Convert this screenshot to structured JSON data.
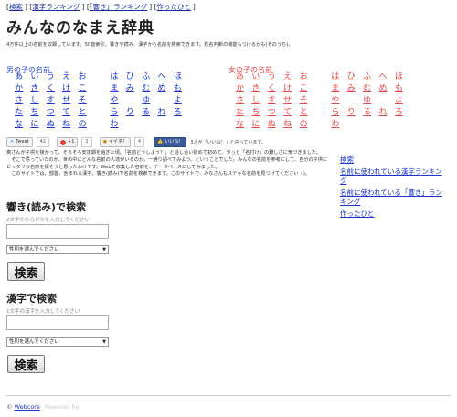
{
  "nav": {
    "links": [
      "検索",
      "漢字ランキング",
      "「響き」ランキング",
      "作ったひと"
    ]
  },
  "title": "みんなのなまえ辞典",
  "intro": "4万件以上の名前を収録しています。50音索引、響きや読み、漢字から名前を検索できます。姓名判断の機能もつけるかも(そのうち)。",
  "boys": {
    "heading": "男の子の名前",
    "rows": [
      [
        "あ",
        "い",
        "う",
        "え",
        "お",
        "",
        "は",
        "ひ",
        "ふ",
        "へ",
        "ほ"
      ],
      [
        "か",
        "き",
        "く",
        "け",
        "こ",
        "",
        "ま",
        "み",
        "む",
        "め",
        "も"
      ],
      [
        "さ",
        "し",
        "す",
        "せ",
        "そ",
        "",
        "や",
        "",
        "ゆ",
        "",
        "よ"
      ],
      [
        "た",
        "ち",
        "つ",
        "て",
        "と",
        "",
        "ら",
        "り",
        "る",
        "れ",
        "ろ"
      ],
      [
        "な",
        "に",
        "ぬ",
        "ね",
        "の",
        "",
        "わ",
        "",
        "",
        "",
        ""
      ]
    ]
  },
  "girls": {
    "heading": "女の子の名前",
    "rows": [
      [
        "あ",
        "い",
        "う",
        "え",
        "お",
        "",
        "は",
        "ひ",
        "ふ",
        "へ",
        "ほ"
      ],
      [
        "か",
        "き",
        "く",
        "け",
        "こ",
        "",
        "ま",
        "み",
        "む",
        "め",
        "も"
      ],
      [
        "さ",
        "し",
        "す",
        "せ",
        "そ",
        "",
        "や",
        "",
        "ゆ",
        "",
        "よ"
      ],
      [
        "た",
        "ち",
        "つ",
        "て",
        "と",
        "",
        "ら",
        "り",
        "る",
        "れ",
        "ろ"
      ],
      [
        "な",
        "に",
        "ぬ",
        "ね",
        "の",
        "",
        "わ",
        "",
        "",
        "",
        ""
      ]
    ]
  },
  "social": {
    "tweet_label": "Tweet",
    "tweet_count": "42",
    "plus_label": "+1",
    "plus_count": "2",
    "like_label": "イイネ！",
    "like_count": "4",
    "fb_label": "いいね！",
    "fb_text": "3人が「いいね！」と言っています。"
  },
  "description": [
    "奥さんが子供を授かって、そろそろ安定期を過ぎた頃。「名前どうしよう？」と話し合い始めて初めて、やっと「名付け」の難しさに気づきました。",
    "　そこで思っていたのが、世の中にどんな名前の人達がいるのか。一通り調べてみよう。ということでした。みんなの名前を参考にして、自分の子供にピッタリな名前を探そうと思ったわけです。Webで収集した名前を、データベースにしてみました。",
    "　このサイトでは、部首、含まれる漢字、響き(読み)で名前を検索できます。このサイトで、みなさんもステキな名前を見つけてください :-)。"
  ],
  "sidebar": {
    "links": [
      "検索",
      "名前に使われている漢字ランキング",
      "名前に使われている「響き」ランキング",
      "作ったひと"
    ]
  },
  "search_reading": {
    "heading": "響き(読み)で検索",
    "placeholder": "2文字のひらがなを入力してください",
    "select_value": "性別を選んでください",
    "button": "検索"
  },
  "search_kanji": {
    "heading": "漢字で検索",
    "placeholder": "1文字の漢字を入力してください",
    "select_value": "性別を選んでください",
    "button": "検索"
  },
  "footer": {
    "copyright": "©",
    "link": "Webcore",
    "faint": "Powered by"
  }
}
